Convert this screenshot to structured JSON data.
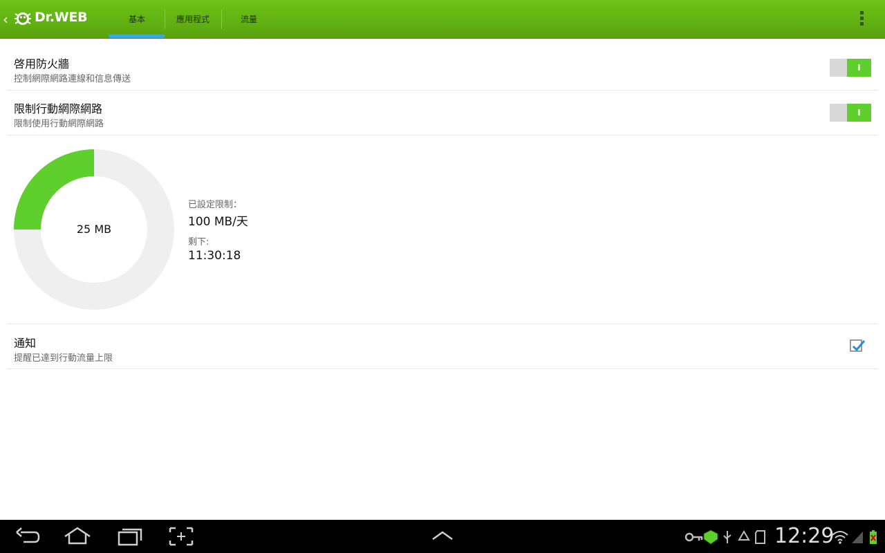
{
  "app": {
    "brand": "Dr.WEB"
  },
  "tabs": [
    {
      "label": "基本",
      "selected": true
    },
    {
      "label": "應用程式",
      "selected": false
    },
    {
      "label": "流量",
      "selected": false
    }
  ],
  "settings": {
    "firewall": {
      "title": "啓用防火牆",
      "subtitle": "控制網際網路連線和信息傳送",
      "toggle": "I",
      "on": true
    },
    "mobile_limit": {
      "title": "限制行動網際網路",
      "subtitle": "限制使用行動網際網路",
      "toggle": "I",
      "on": true
    },
    "notify": {
      "title": "通知",
      "subtitle": "提醒已達到行動流量上限",
      "checked": true
    }
  },
  "usage": {
    "used_label": "25 MB",
    "used_fraction": 0.25,
    "limit_caption": "已設定限制：",
    "limit_value": "100 MB/天",
    "remaining_caption": "剩下:",
    "remaining_value": "11:30:18"
  },
  "status_bar": {
    "clock": "12:29"
  },
  "colors": {
    "accent_green": "#5ecf2c",
    "topbar": "#6cc417",
    "tab_indicator": "#36a9e1",
    "check_blue": "#2a8fd0"
  }
}
